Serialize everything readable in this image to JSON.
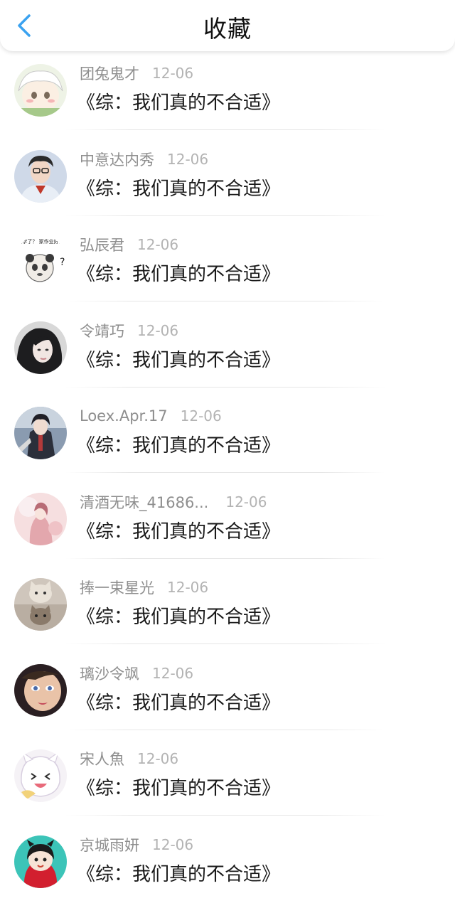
{
  "header": {
    "title": "收藏",
    "back_icon": "chevron-left-icon",
    "accent_color": "#3aa2f0"
  },
  "items": [
    {
      "username": "团兔鬼才",
      "date": "12-06",
      "text": "《综：我们真的不合适》",
      "avatar_icon": "avatar-anime-girl-icon"
    },
    {
      "username": "中意达内秀",
      "date": "12-06",
      "text": "《综：我们真的不合适》",
      "avatar_icon": "avatar-man-photo-icon"
    },
    {
      "username": "弘辰君",
      "date": "12-06",
      "text": "《综：我们真的不合适》",
      "avatar_icon": "avatar-panda-meme-icon",
      "avatar_caption": "大雾要上学了？\n家作业好像还没？"
    },
    {
      "username": "令靖巧",
      "date": "12-06",
      "text": "《综：我们真的不合适》",
      "avatar_icon": "avatar-woman-dark-hair-icon"
    },
    {
      "username": "Loex.Apr.17",
      "date": "12-06",
      "text": "《综：我们真的不合适》",
      "avatar_icon": "avatar-anime-character-icon"
    },
    {
      "username": "清酒无味_41686...",
      "date": "12-06",
      "text": "《综：我们真的不合适》",
      "avatar_icon": "avatar-pink-illustration-icon"
    },
    {
      "username": "捧一束星光",
      "date": "12-06",
      "text": "《综：我们真的不合适》",
      "avatar_icon": "avatar-cats-icon"
    },
    {
      "username": "璃沙令飒",
      "date": "12-06",
      "text": "《综：我们真的不合适》",
      "avatar_icon": "avatar-woman-makeup-icon"
    },
    {
      "username": "宋人魚",
      "date": "12-06",
      "text": "《综：我们真的不合适》",
      "avatar_icon": "avatar-cartoon-laughing-icon"
    },
    {
      "username": "京城雨妍",
      "date": "12-06",
      "text": "《综：我们真的不合适》",
      "avatar_icon": "avatar-cartoon-devil-girl-icon"
    }
  ]
}
